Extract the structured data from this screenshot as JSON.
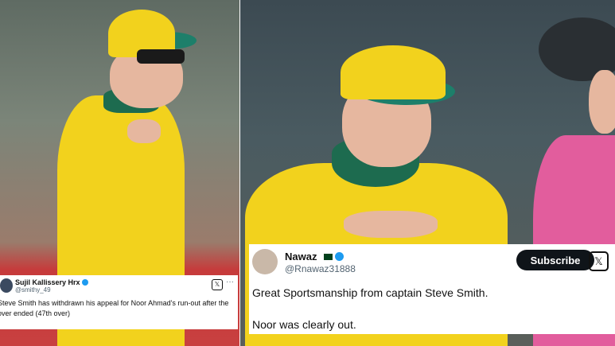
{
  "left_tweet": {
    "author": "Sujil Kallissery Hrx",
    "handle": "@smithy_49",
    "text": "Steve Smith has withdrawn his appeal for Noor Ahmad's run-out after the over ended (47th over)",
    "more": "···",
    "icon": "x-logo-icon"
  },
  "right_tweet": {
    "author": "Nawaz",
    "handle": "@Rnawaz31888",
    "subscribe_label": "Subscribe",
    "line1": "Great Sportsmanship from captain Steve Smith.",
    "line2": "Noor was clearly out.",
    "icon": "x-logo-icon"
  },
  "colors": {
    "jersey_yellow": "#f2d21d",
    "jersey_green": "#1d6b4f",
    "umpire_pink": "#e25d9d",
    "verified_blue": "#1d9bf0"
  }
}
